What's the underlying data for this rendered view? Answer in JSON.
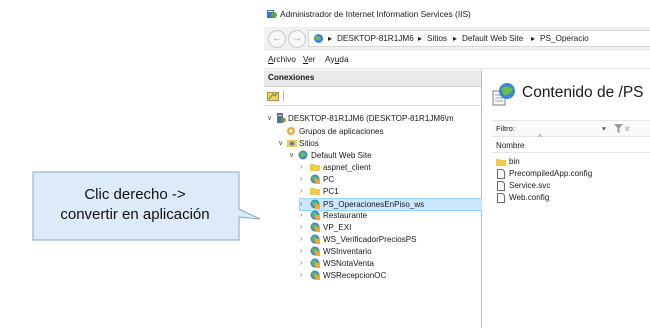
{
  "window": {
    "title": "Administrador de Internet Information Services (IIS)",
    "app_icon": "iis-manager-icon"
  },
  "address": {
    "crumbs": [
      "DESKTOP-81R1JM6",
      "Sitios",
      "Default Web Site",
      "PS_Operacio"
    ]
  },
  "menu": {
    "archivo_pre": "",
    "archivo_u": "A",
    "archivo_post": "rchivo",
    "ver_pre": "",
    "ver_u": "V",
    "ver_post": "er",
    "ayuda_pre": "Ay",
    "ayuda_u": "u",
    "ayuda_post": "da"
  },
  "connections": {
    "header": "Conexiones",
    "server": "DESKTOP-81R1JM6 (DESKTOP-81R1JM6\\m",
    "app_pools": "Grupos de aplicaciones",
    "sites": "Sitios",
    "default_site": "Default Web Site",
    "children": [
      {
        "label": "aspnet_client",
        "kind": "folder"
      },
      {
        "label": "PC",
        "kind": "app"
      },
      {
        "label": "PC1",
        "kind": "folder"
      },
      {
        "label": "PS_OperacionesEnPiso_ws",
        "kind": "app",
        "selected": true
      },
      {
        "label": "Restaurante",
        "kind": "app"
      },
      {
        "label": "VP_EXI",
        "kind": "app"
      },
      {
        "label": "WS_VerificadorPreciosPS",
        "kind": "app"
      },
      {
        "label": "WSInventario",
        "kind": "app"
      },
      {
        "label": "WSNotaVenta",
        "kind": "app"
      },
      {
        "label": "WSRecepcionOC",
        "kind": "app"
      }
    ]
  },
  "content": {
    "title": "Contenido de /PS",
    "filter_label": "Filtro:",
    "column_name": "Nombre",
    "files": [
      {
        "label": "bin",
        "kind": "folder"
      },
      {
        "label": "PrecompiledApp.config",
        "kind": "file"
      },
      {
        "label": "Service.svc",
        "kind": "file"
      },
      {
        "label": "Web.config",
        "kind": "file"
      }
    ]
  },
  "callout": {
    "line1": "Clic derecho ->",
    "line2": "convertir en aplicación",
    "fill": "#dcebf7",
    "stroke": "#7fa7cc"
  }
}
